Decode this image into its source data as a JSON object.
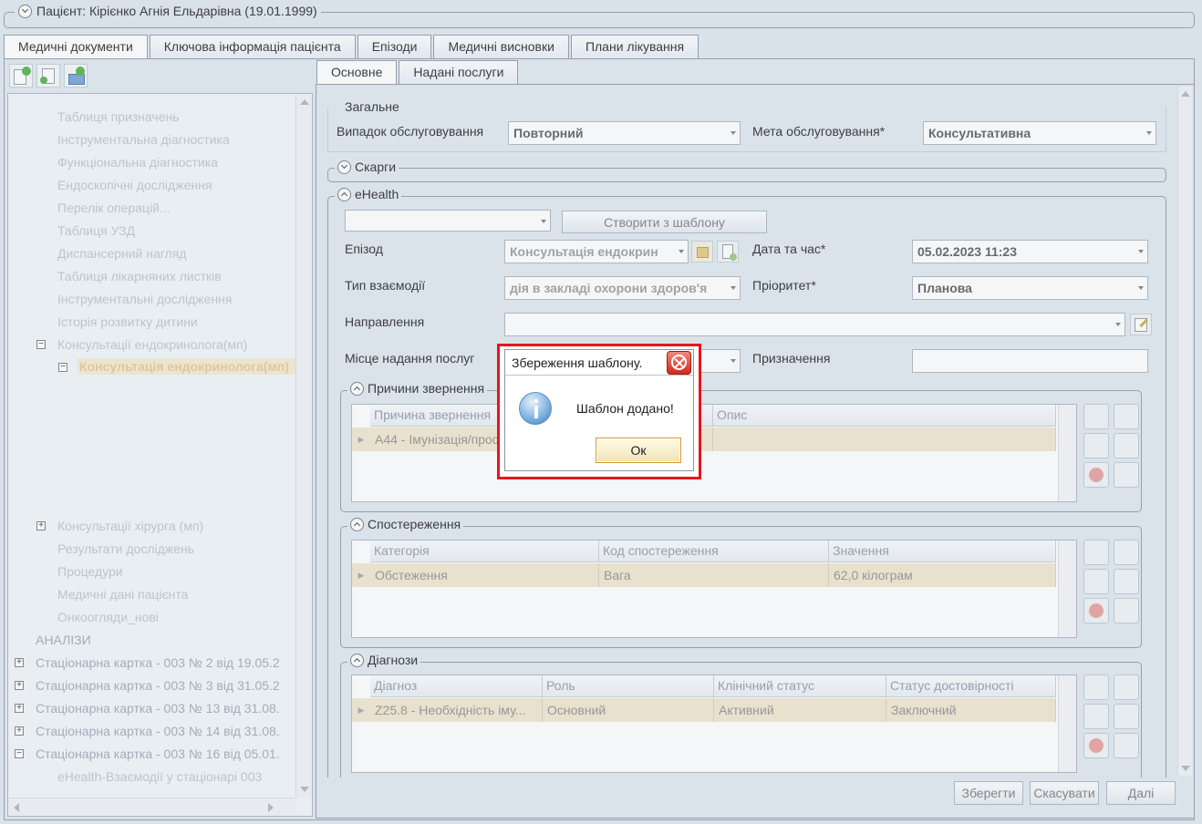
{
  "patient": {
    "label": "Пацієнт: Кірієнко Агнія Ельдарівна (19.01.1999)"
  },
  "main_tabs": [
    "Медичні документи",
    "Ключова інформація пацієнта",
    "Епізоди",
    "Медичні висновки",
    "Плани лікування"
  ],
  "sub_tabs": [
    "Основне",
    "Надані послуги"
  ],
  "tree": {
    "items": [
      {
        "label": "Таблиця призначень"
      },
      {
        "label": "Інструментальна діагностика"
      },
      {
        "label": "Функціональна діагностика"
      },
      {
        "label": "Ендоскопічні дослідження"
      },
      {
        "label": "Перелік операцій..."
      },
      {
        "label": "Таблиця УЗД"
      },
      {
        "label": "Диспансерний нагляд"
      },
      {
        "label": "Таблиця лікарняних листків"
      },
      {
        "label": "Інструментальні дослідження"
      },
      {
        "label": "Історія розвитку дитини"
      },
      {
        "label": "Консультації ендокринолога(мп)"
      },
      {
        "label": "Консультація ендокринолога(мп)"
      },
      {
        "label": "Консультації хірурга (мп)"
      },
      {
        "label": "Результати досліджень"
      },
      {
        "label": "Процедури"
      },
      {
        "label": "Медичні дані пацієнта"
      },
      {
        "label": "Онкоогляди_нові"
      },
      {
        "label": "АНАЛІЗИ"
      },
      {
        "label": "Стаціонарна картка - 003 № 2 від 19.05.2"
      },
      {
        "label": "Стаціонарна картка - 003 № 3 від 31.05.2"
      },
      {
        "label": "Стаціонарна картка - 003 № 13 від 31.08."
      },
      {
        "label": "Стаціонарна картка - 003 № 14 від 31.08."
      },
      {
        "label": "Стаціонарна картка - 003 № 16 від 05.01."
      },
      {
        "label": "eHealth-Взаємодії у стаціонарі 003"
      }
    ]
  },
  "general": {
    "title": "Загальне",
    "case_label": "Випадок обслуговування",
    "case_value": "Повторний",
    "goal_label": "Мета обслуговування*",
    "goal_value": "Консультативна"
  },
  "complaints": {
    "title": "Скарги"
  },
  "ehealth": {
    "title": "eHealth",
    "template_button": "Створити з шаблону",
    "episode_label": "Епізод",
    "episode_value": "Консультація ендокрин",
    "datetime_label": "Дата та час*",
    "datetime_value": "05.02.2023 11:23",
    "interaction_label": "Тип взаємодії",
    "interaction_value": "дія в закладі охорони здоров'я",
    "priority_label": "Пріоритет*",
    "priority_value": "Планова",
    "referral_label": "Направлення",
    "place_label": "Місце надання послуг",
    "assignment_label": "Призначення"
  },
  "reasons": {
    "title": "Причини звернення",
    "columns": [
      "Причина звернення",
      "Опис"
    ],
    "rows": [
      [
        "A44 - Імунізація/профілактика",
        ""
      ]
    ]
  },
  "observations": {
    "title": "Спостереження",
    "columns": [
      "Категорія",
      "Код спостереження",
      "Значення"
    ],
    "rows": [
      [
        "Обстеження",
        "Вага",
        "62,0 кілограм"
      ]
    ]
  },
  "diagnoses": {
    "title": "Діагнози",
    "columns": [
      "Діагноз",
      "Роль",
      "Клінічний статус",
      "Статус достовірності"
    ],
    "rows": [
      [
        "Z25.8 - Необхідність іму...",
        "Основний",
        "Активний",
        "Заключний"
      ]
    ]
  },
  "footer": {
    "save": "Зберегти",
    "cancel": "Скасувати",
    "next": "Далі"
  },
  "dialog": {
    "title": "Збереження шаблону.",
    "message": "Шаблон додано!",
    "ok": "Ок"
  },
  "colors": {
    "highlight_border": "#e8141c",
    "row_selected": "#efe6cc",
    "accent": "#3b78c4"
  }
}
